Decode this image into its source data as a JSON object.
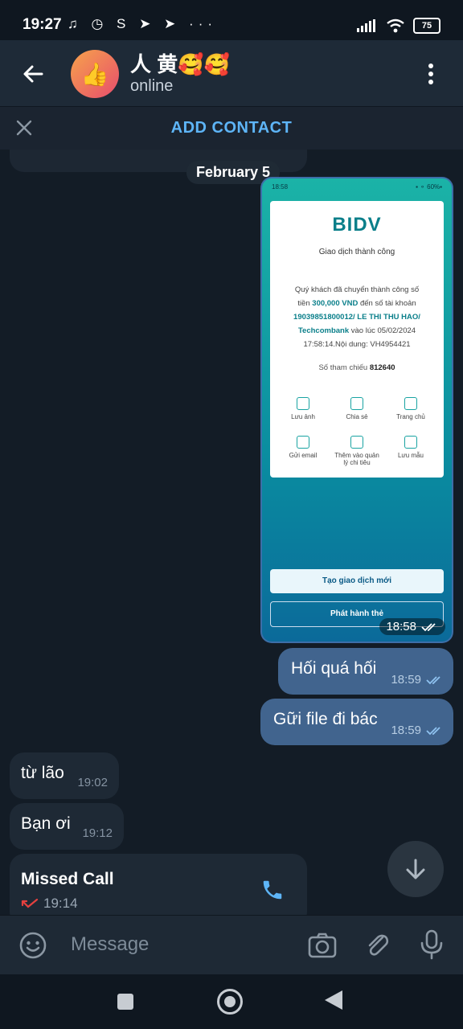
{
  "status_bar": {
    "time": "19:27",
    "icons": "♫ ◷ S ➤ ➤ ···",
    "battery": "75"
  },
  "header": {
    "contact_name": "人 黄🥰🥰",
    "status": "online",
    "avatar_emoji": "👍"
  },
  "add_contact": {
    "label": "ADD CONTACT"
  },
  "chat": {
    "date_chip": "February 5",
    "image_message": {
      "time": "18:58",
      "receipt": {
        "status_time": "18:58",
        "status_right": "▪ ⚬ 60%▪",
        "brand": "BIDV",
        "subtitle": "Giao dịch thành công",
        "line1": "Quý khách đã chuyển thành công số",
        "line2_pre": "tiền ",
        "amount": "300,000 VND",
        "line2_post": " đến số tài khoản",
        "account": "19039851800012/ LE THI THU HAO/",
        "bank": "Techcombank",
        "line4_post": " vào lúc 05/02/2024",
        "line5": "17:58:14.Nội dung: VH4954421",
        "ref_label": "Số tham chiếu ",
        "ref_value": "812640",
        "actions": [
          "Lưu ảnh",
          "Chia sẻ",
          "Trang chủ",
          "Gửi email",
          "Thêm vào quản lý chi tiêu",
          "Lưu mẫu"
        ],
        "btn_new": "Tạo giao dịch mới",
        "btn_card": "Phát hành thẻ"
      }
    },
    "messages": [
      {
        "text": "Hối quá hối",
        "time": "18:59",
        "direction": "out"
      },
      {
        "text": "Gữi file đi bác",
        "time": "18:59",
        "direction": "out"
      },
      {
        "text": "từ lão",
        "time": "19:02",
        "direction": "in"
      },
      {
        "text": "Bạn ơi",
        "time": "19:12",
        "direction": "in"
      }
    ],
    "missed_call": {
      "title": "Missed Call",
      "time": "19:14"
    }
  },
  "input": {
    "placeholder": "Message"
  },
  "colors": {
    "accent": "#5eb5f7",
    "outgoing_bubble": "#41648e",
    "incoming_bubble": "#1e2935",
    "missed_call": "#e5413f"
  }
}
